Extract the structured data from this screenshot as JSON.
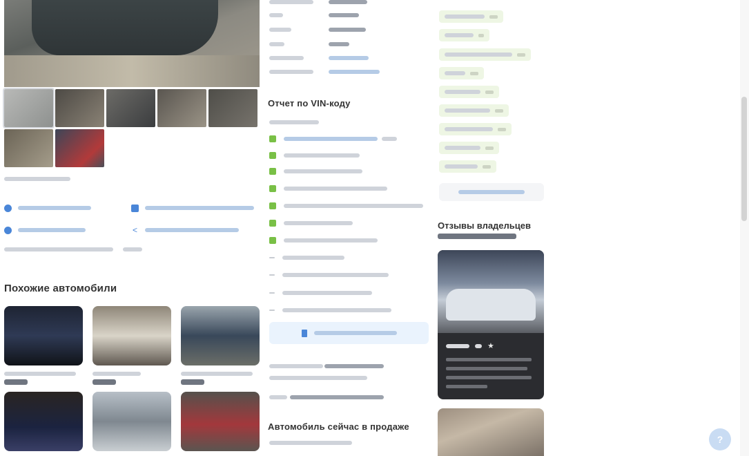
{
  "headings": {
    "vin_report": "Отчет по VIN-коду",
    "similar": "Похожие автомобили",
    "reviews": "Отзывы владельцев",
    "market": "Автомобиль сейчас в продаже"
  },
  "colors": {
    "accent": "#4a86d8",
    "check_ok": "#79c046",
    "tag_bg": "#eef6e4",
    "report_button_bg": "#eaf3fd"
  },
  "icons": {
    "scroll_thumb": "scrollbar-thumb",
    "help": "help-icon"
  }
}
